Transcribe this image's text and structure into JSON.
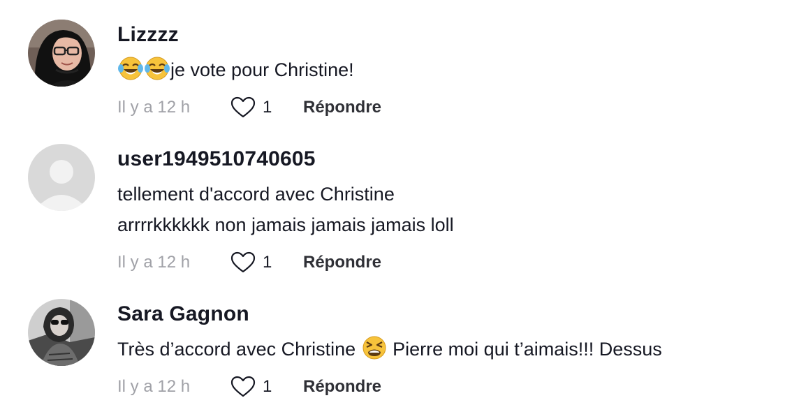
{
  "comments": [
    {
      "username": "Lizzzz",
      "lines": [
        "je vote pour Christine!"
      ],
      "lead_emojis": [
        "face-with-tears-of-joy",
        "face-with-tears-of-joy"
      ],
      "time": "Il y a 12 h",
      "likes": "1",
      "reply_label": "Répondre"
    },
    {
      "username": "user1949510740605",
      "lines": [
        "tellement d'accord avec Christine",
        "arrrrkkkkkk non jamais jamais jamais loll"
      ],
      "time": "Il y a 12 h",
      "likes": "1",
      "reply_label": "Répondre"
    },
    {
      "username": "Sara Gagnon",
      "text_before_emoji": "Très d’accord avec Christine ",
      "emoji": "tired-face",
      "text_after_emoji": " Pierre moi qui t’aimais!!! Dessus",
      "time": "Il y a 12 h",
      "likes": "1",
      "reply_label": "Répondre"
    }
  ],
  "colors": {
    "text": "#161823",
    "muted": "#a0a1a7",
    "reply": "#2f3036",
    "placeholder_avatar_bg": "#d9d9d9"
  }
}
